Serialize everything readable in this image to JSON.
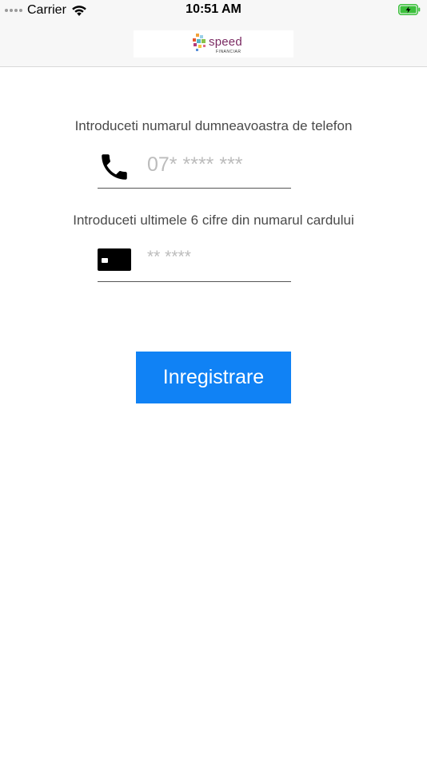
{
  "status_bar": {
    "carrier": "Carrier",
    "time": "10:51 AM",
    "battery_color": "#3cc03c"
  },
  "header": {
    "logo_text": "speed",
    "logo_subtext": "FINANCIAR"
  },
  "form": {
    "phone_label": "Introduceti numarul dumneavoastra de telefon",
    "phone_placeholder": "07* **** ***",
    "phone_icon": "phone-icon",
    "card_label": "Introduceti ultimele 6 cifre din numarul cardului",
    "card_placeholder": "** ****",
    "card_icon": "credit-card-icon",
    "submit_label": "Inregistrare",
    "submit_color": "#1082f5"
  }
}
